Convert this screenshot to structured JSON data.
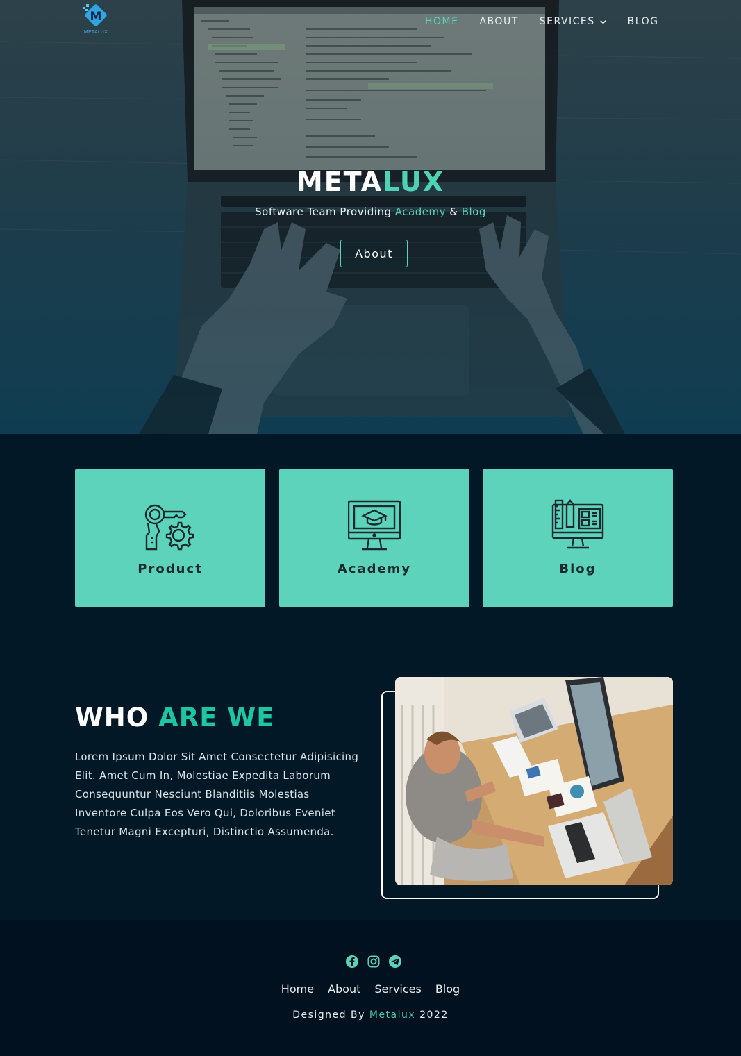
{
  "colors": {
    "accent": "#5bd3b9",
    "card_bg": "#5dd3bb",
    "page_bg": "#021826",
    "footer_bg": "#02111f"
  },
  "header": {
    "logo_letter": "M",
    "logo_text": "METALUX",
    "nav": [
      {
        "label": "HOME",
        "active": true
      },
      {
        "label": "ABOUT",
        "active": false
      },
      {
        "label": "SERVICES",
        "active": false,
        "dropdown": true
      },
      {
        "label": "BLOG",
        "active": false
      }
    ]
  },
  "hero": {
    "title_part1": "META",
    "title_part2": "LUX",
    "subtitle_start": "Software Team Providing ",
    "subtitle_academy": "Academy",
    "subtitle_amp": " & ",
    "subtitle_blog": "Blog",
    "button_label": "About"
  },
  "services": [
    {
      "label": "Product",
      "icon": "product-gear-icon"
    },
    {
      "label": "Academy",
      "icon": "academy-monitor-icon"
    },
    {
      "label": "Blog",
      "icon": "blog-monitor-icon"
    }
  ],
  "about": {
    "title_part1": "WHO",
    "title_part2": "ARE WE",
    "text": "Lorem Ipsum Dolor Sit Amet Consectetur Adipisicing Elit. Amet Cum In, Molestiae Expedita Laborum Consequuntur Nesciunt Blanditiis Molestias Inventore Culpa Eos Vero Qui, Doloribus Eveniet Tenetur Magni Excepturi, Distinctio Assumenda."
  },
  "footer": {
    "socials": [
      "facebook-icon",
      "instagram-icon",
      "telegram-icon"
    ],
    "links": [
      "Home",
      "About",
      "Services",
      "Blog"
    ],
    "credit_start": "Designed By ",
    "credit_brand": "Metalux",
    "credit_year": " 2022"
  }
}
